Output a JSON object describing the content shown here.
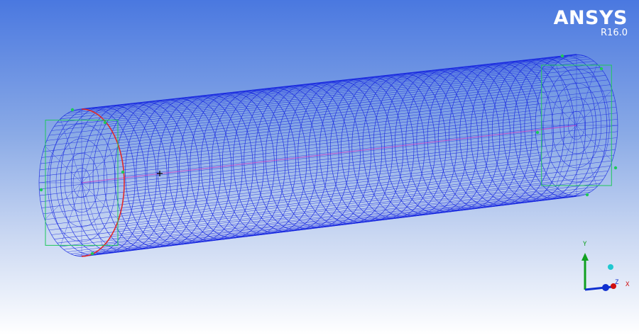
{
  "brand": {
    "name": "ANSYS",
    "version": "R16.0"
  },
  "viewport": {
    "model": "wireframe-cylinder-mesh",
    "colors": {
      "background_top": "#4a78e0",
      "background_bottom": "#ffffff",
      "mesh": "#1a2ae0",
      "edge_highlight": "#e02a2a",
      "boundary": "#1ec85a",
      "axis_line": "#c030c0"
    }
  },
  "triad": {
    "x_label": "X",
    "y_label": "Y",
    "z_label": "Z",
    "x_color": "#d01010",
    "y_color": "#10a020",
    "z_color": "#1030d0",
    "iso_color": "#20c8d0"
  }
}
